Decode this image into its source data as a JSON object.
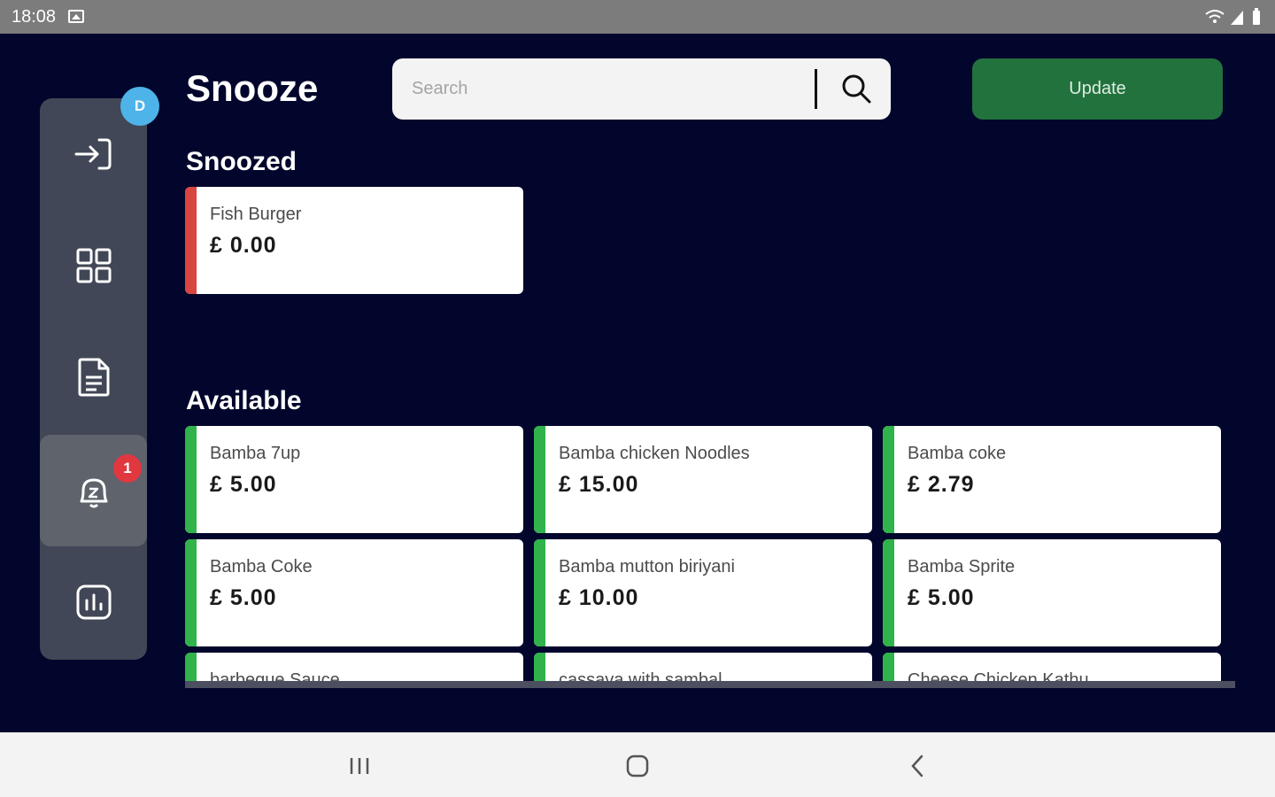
{
  "status_bar": {
    "time": "18:08"
  },
  "sidebar": {
    "user_badge": "D",
    "items": [
      {
        "name": "login-icon"
      },
      {
        "name": "grid-icon"
      },
      {
        "name": "document-icon"
      },
      {
        "name": "snooze-bell-icon",
        "badge": "1",
        "active": true
      },
      {
        "name": "chart-icon"
      }
    ]
  },
  "header": {
    "title": "Snooze",
    "search_placeholder": "Search",
    "update_label": "Update"
  },
  "snoozed": {
    "title": "Snoozed",
    "items": [
      {
        "name": "Fish Burger",
        "price": "£ 0.00"
      }
    ]
  },
  "available": {
    "title": "Available",
    "items": [
      {
        "name": "Bamba 7up",
        "price": "£ 5.00"
      },
      {
        "name": "Bamba chicken Noodles",
        "price": "£ 15.00"
      },
      {
        "name": "Bamba coke",
        "price": "£ 2.79"
      },
      {
        "name": "Bamba Coke",
        "price": "£ 5.00"
      },
      {
        "name": "Bamba mutton biriyani",
        "price": "£ 10.00"
      },
      {
        "name": "Bamba Sprite",
        "price": "£ 5.00"
      },
      {
        "name": "barbeque Sauce",
        "price": ""
      },
      {
        "name": "cassava with sambal",
        "price": ""
      },
      {
        "name": "Cheese Chicken Kathu",
        "price": ""
      }
    ]
  },
  "colors": {
    "background": "#02062c",
    "snoozed_stripe": "#d9453f",
    "available_stripe": "#2fb34a",
    "update_button": "#22723d",
    "badge_blue": "#4eb3e9",
    "badge_red": "#e1373f"
  }
}
